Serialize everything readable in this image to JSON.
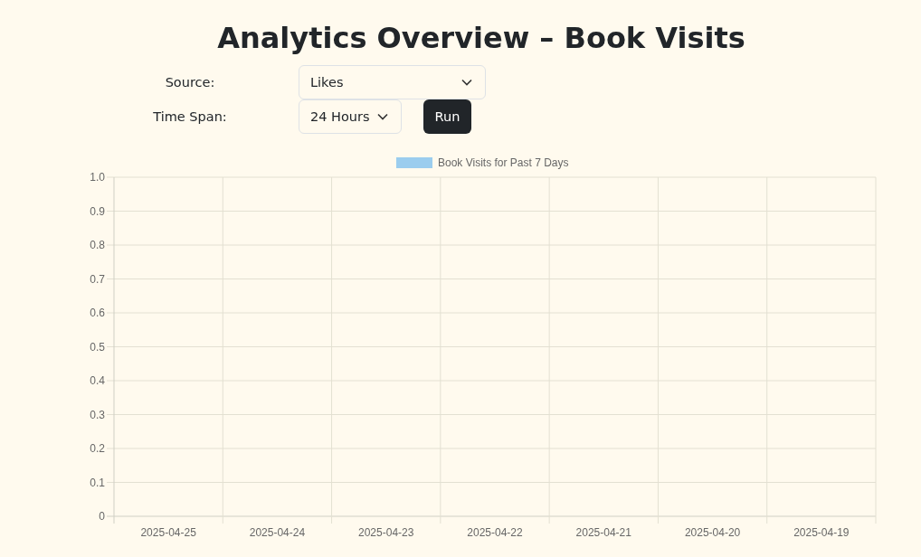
{
  "title": "Analytics Overview – Book Visits",
  "controls": {
    "source": {
      "label": "Source:",
      "value": "Likes"
    },
    "time_span": {
      "label": "Time Span:",
      "value": "24 Hours"
    },
    "run_button": "Run"
  },
  "chart": {
    "chart_data": {
      "type": "bar",
      "categories": [
        "2025-04-25",
        "2025-04-24",
        "2025-04-23",
        "2025-04-22",
        "2025-04-21",
        "2025-04-20",
        "2025-04-19"
      ],
      "series": [
        {
          "name": "Book Visits for Past 7 Days",
          "color": "#9bcdee",
          "values": [
            0,
            0,
            0,
            0,
            0,
            0,
            0
          ]
        }
      ],
      "ylim": [
        0,
        1
      ],
      "grid": true,
      "yticks": [
        0,
        {
          "value": 0.1,
          "label": "0.1"
        },
        {
          "value": 0.2,
          "label": "0.2"
        },
        {
          "value": 0.3,
          "label": "0.3"
        },
        {
          "value": 0.4,
          "label": "0.4"
        },
        {
          "value": 0.5,
          "label": "0.5"
        },
        {
          "value": 0.6,
          "label": "0.6"
        },
        {
          "value": 0.7,
          "label": "0.7"
        },
        {
          "value": 0.8,
          "label": "0.8"
        },
        {
          "value": 0.9,
          "label": "0.9"
        },
        {
          "value": 1,
          "label": "1.0"
        }
      ]
    }
  }
}
